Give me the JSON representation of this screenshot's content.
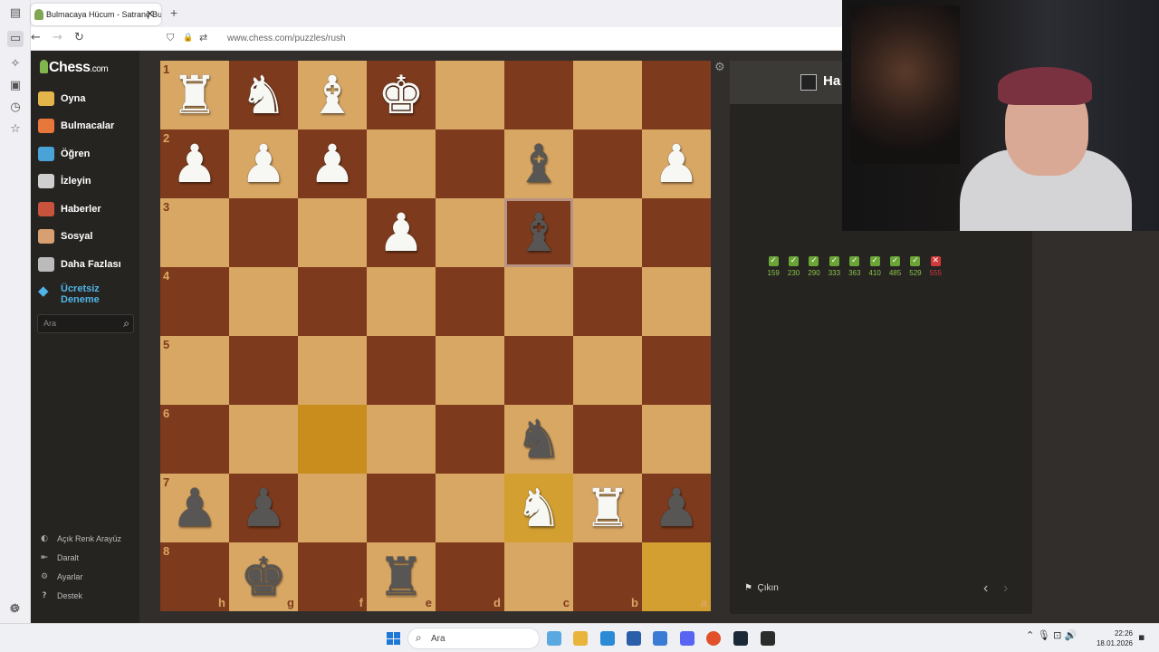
{
  "browser": {
    "tab_title": "Bulmacaya Hücum - Satranç Bu",
    "tab_close": "✕",
    "new_tab": "+",
    "url": "www.chess.com/puzzles/rush",
    "back": "←",
    "forward": "→",
    "reload": "↻",
    "shield": "⛉",
    "lock": "🔒",
    "perm": "⇄"
  },
  "sidebar": {
    "logo": "Chess",
    "logo_suffix": ".com",
    "items": [
      {
        "label": "Oyna",
        "color": "#e3b54a"
      },
      {
        "label": "Bulmacalar",
        "color": "#e8773b"
      },
      {
        "label": "Öğren",
        "color": "#4aa3d6"
      },
      {
        "label": "İzleyin",
        "color": "#cfcfcf"
      },
      {
        "label": "Haberler",
        "color": "#c7533c"
      },
      {
        "label": "Sosyal",
        "color": "#d8a070"
      },
      {
        "label": "Daha Fazlası",
        "color": "#bbbbbb"
      }
    ],
    "trial_line1": "Ücretsiz",
    "trial_line2": "Deneme",
    "search_placeholder": "Ara",
    "footer": [
      {
        "label": "Açık Renk Arayüz",
        "icon": "◐"
      },
      {
        "label": "Daralt",
        "icon": "⇤"
      },
      {
        "label": "Ayarlar",
        "icon": "⚙"
      },
      {
        "label": "Destek",
        "icon": "?"
      }
    ]
  },
  "board": {
    "ranks": [
      "1",
      "2",
      "3",
      "4",
      "5",
      "6",
      "7",
      "8"
    ],
    "files": [
      "h",
      "g",
      "f",
      "e",
      "d",
      "c",
      "b",
      "a"
    ],
    "pieces": {
      "0": {
        "glyph": "♜",
        "side": "w"
      },
      "1": {
        "glyph": "♞",
        "side": "w"
      },
      "2": {
        "glyph": "♝",
        "side": "w"
      },
      "3": {
        "glyph": "♚",
        "side": "w"
      },
      "8": {
        "glyph": "♟",
        "side": "w"
      },
      "9": {
        "glyph": "♟",
        "side": "w"
      },
      "10": {
        "glyph": "♟",
        "side": "w"
      },
      "13": {
        "glyph": "♝",
        "side": "b"
      },
      "15": {
        "glyph": "♟",
        "side": "w"
      },
      "19": {
        "glyph": "♟",
        "side": "w"
      },
      "21": {
        "glyph": "♝",
        "side": "b"
      },
      "45": {
        "glyph": "♞",
        "side": "b"
      },
      "48": {
        "glyph": "♟",
        "side": "b"
      },
      "49": {
        "glyph": "♟",
        "side": "b"
      },
      "53": {
        "glyph": "♞",
        "side": "w"
      },
      "54": {
        "glyph": "♜",
        "side": "w"
      },
      "55": {
        "glyph": "♟",
        "side": "b"
      },
      "57": {
        "glyph": "♚",
        "side": "b"
      },
      "59": {
        "glyph": "♜",
        "side": "b"
      }
    },
    "highlight_squares": [
      42,
      53,
      63
    ],
    "selected_square": 21
  },
  "panel": {
    "title": "Ha",
    "results": [
      {
        "score": "159",
        "ok": true
      },
      {
        "score": "230",
        "ok": true
      },
      {
        "score": "290",
        "ok": true
      },
      {
        "score": "333",
        "ok": true
      },
      {
        "score": "363",
        "ok": true
      },
      {
        "score": "410",
        "ok": true
      },
      {
        "score": "485",
        "ok": true
      },
      {
        "score": "529",
        "ok": true
      },
      {
        "score": "555",
        "ok": false
      }
    ],
    "exit_label": "Çıkın",
    "exit_icon": "⚑",
    "prev": "‹",
    "next": "›"
  },
  "taskbar": {
    "search": "Ara",
    "tray": "⌃  🎙  ⊡  🔊",
    "time": "22:26",
    "date": "18.01.2026",
    "icons": [
      "#5aa8e0",
      "#e8b43a",
      "#2b8ad6",
      "#2a5ea8",
      "#3b7bd6",
      "#5865f2",
      "#e2502b",
      "#1b2838",
      "#2b2b2b"
    ]
  }
}
